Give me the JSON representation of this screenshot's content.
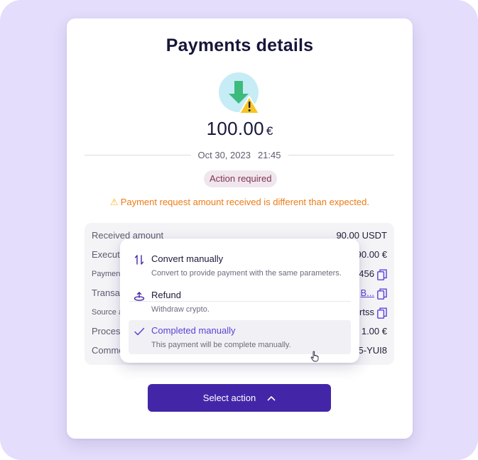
{
  "colors": {
    "accent": "#4326a8",
    "link": "#5b3fd6",
    "warning_text": "#ec7b16",
    "badge_bg": "#f0e6ee",
    "badge_text": "#80344f",
    "frame_bg": "#e4ddfb"
  },
  "header": {
    "title": "Payments details"
  },
  "payment": {
    "icon": "download-warning-icon",
    "amount": "100.00",
    "currency": "€",
    "date": "Oct 30, 2023",
    "time": "21:45",
    "status_badge": "Action required",
    "warning_icon": "warning-triangle-icon",
    "warning_message": "Payment request amount received is different than expected."
  },
  "details": {
    "rows": [
      {
        "label": "Received amount",
        "value": "90.00 USDT"
      },
      {
        "label": "Execute",
        "value": "90.00 €"
      },
      {
        "label": "Paymen",
        "value": "456",
        "copy": true
      },
      {
        "label": "Transac",
        "value": "B...",
        "copy": true,
        "link": true
      },
      {
        "label": "Source a",
        "value": "rtss",
        "copy": true
      },
      {
        "label": "Process",
        "value": "1.00 €"
      },
      {
        "label": "Comme",
        "value": "5-YUI8"
      }
    ]
  },
  "dropdown": {
    "options": [
      {
        "icon": "convert-arrows-icon",
        "title": "Convert manually",
        "description": "Convert to provide payment with the same parameters."
      },
      {
        "icon": "refund-icon",
        "title": "Refund",
        "description": "Withdraw crypto."
      },
      {
        "icon": "check-icon",
        "title": "Completed manually",
        "description": "This payment will be complete manually.",
        "selected": true
      }
    ]
  },
  "action_button": {
    "label": "Select action",
    "icon": "chevron-up-icon"
  }
}
